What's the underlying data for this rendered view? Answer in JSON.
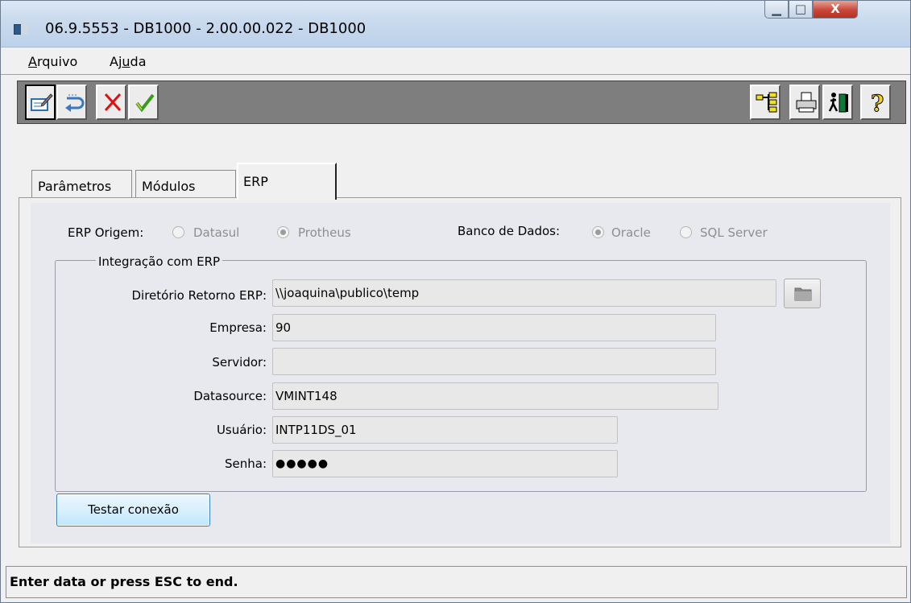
{
  "window": {
    "title": "06.9.5553 - DB1000 - 2.00.00.022 - DB1000",
    "minimize_glyph": "▁",
    "maximize_glyph": "□",
    "close_glyph": "X"
  },
  "menu": {
    "arquivo": {
      "pre": "",
      "u": "A",
      "post": "rquivo"
    },
    "ajuda": {
      "pre": "Aj",
      "u": "u",
      "post": "da"
    }
  },
  "toolbar": {
    "left_icons": [
      "edit-icon",
      "undo-icon",
      "cancel-x-icon",
      "confirm-check-icon"
    ],
    "right_icons": [
      "tree-structure-icon",
      "print-icon",
      "exit-icon",
      "help-question-icon"
    ],
    "help_glyph": "?"
  },
  "tabs": {
    "parametros": "Parâmetros",
    "modulos": "Módulos",
    "erp": "ERP"
  },
  "erp_origem": {
    "label": "ERP Origem:",
    "options": [
      "Datasul",
      "Protheus"
    ],
    "selected": "Protheus"
  },
  "banco_dados": {
    "label": "Banco de Dados:",
    "options": [
      "Oracle",
      "SQL Server"
    ],
    "selected": "Oracle"
  },
  "group": {
    "title": "Integração com ERP",
    "diretorio_label": "Diretório Retorno ERP:",
    "diretorio_value": "\\\\joaquina\\publico\\temp",
    "empresa_label": "Empresa:",
    "empresa_value": "90",
    "servidor_label": "Servidor:",
    "servidor_value": "",
    "datasource_label": "Datasource:",
    "datasource_value": "VMINT148",
    "usuario_label": "Usuário:",
    "usuario_value": "INTP11DS_01",
    "senha_label": "Senha:",
    "senha_value": "●●●●●"
  },
  "test_button": "Testar conexão",
  "status": "Enter data or press ESC to end.",
  "colors": {
    "titlebar": "#c9daee",
    "toolbar": "#7e7e7e",
    "cancel_red": "#e01010",
    "check_green": "#3a9a1a",
    "panel": "#e7e9ee"
  }
}
